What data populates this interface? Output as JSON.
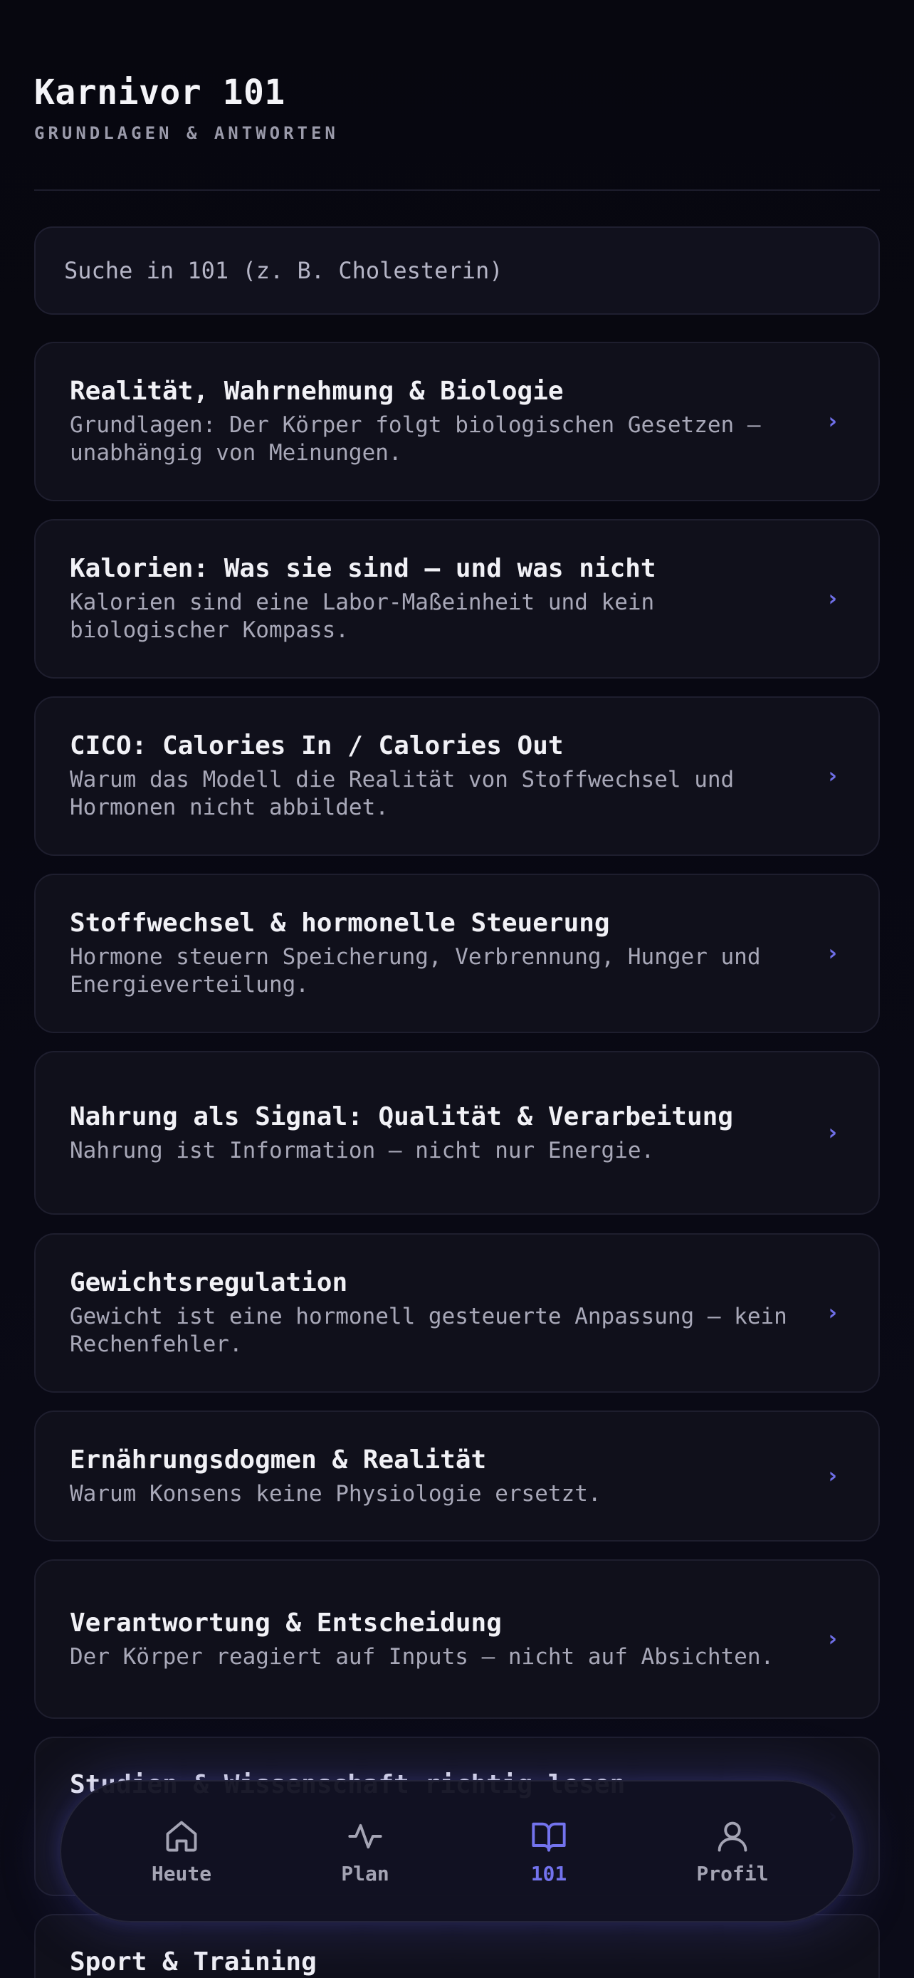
{
  "header": {
    "title": "Karnivor 101",
    "subtitle": "GRUNDLAGEN & ANTWORTEN"
  },
  "search": {
    "placeholder": "Suche in 101 (z. B. Cholesterin)",
    "value": ""
  },
  "topics": [
    {
      "title": "Realität, Wahrnehmung & Biologie",
      "description": "Grundlagen: Der Körper folgt biologischen Gesetzen — unabhängig von Meinungen."
    },
    {
      "title": "Kalorien: Was sie sind — und was nicht",
      "description": "Kalorien sind eine Labor-Maßeinheit und kein biologischer Kompass."
    },
    {
      "title": "CICO: Calories In / Calories Out",
      "description": "Warum das Modell die Realität von Stoffwechsel und Hormonen nicht abbildet."
    },
    {
      "title": "Stoffwechsel & hormonelle Steuerung",
      "description": "Hormone steuern Speicherung, Verbrennung, Hunger und Energieverteilung."
    },
    {
      "title": "Nahrung als Signal: Qualität & Verarbeitung",
      "description": "Nahrung ist Information — nicht nur Energie."
    },
    {
      "title": "Gewichtsregulation",
      "description": "Gewicht ist eine hormonell gesteuerte Anpassung — kein Rechenfehler."
    },
    {
      "title": "Ernährungsdogmen & Realität",
      "description": "Warum Konsens keine Physiologie ersetzt."
    },
    {
      "title": "Verantwortung & Entscheidung",
      "description": "Der Körper reagiert auf Inputs — nicht auf Absichten."
    },
    {
      "title": "Studien & Wissenschaft richtig lesen",
      "description": ""
    },
    {
      "title": "Sport & Training",
      "description": ""
    }
  ],
  "chevron": "›",
  "nav": {
    "items": [
      {
        "label": "Heute",
        "icon": "home-icon"
      },
      {
        "label": "Plan",
        "icon": "activity-icon"
      },
      {
        "label": "101",
        "icon": "book-icon"
      },
      {
        "label": "Profil",
        "icon": "user-icon"
      }
    ],
    "active_index": 2
  },
  "colors": {
    "background": "#07070f",
    "card": "#10101b",
    "accent": "#7373ee",
    "muted_text": "#a8a8b8"
  }
}
